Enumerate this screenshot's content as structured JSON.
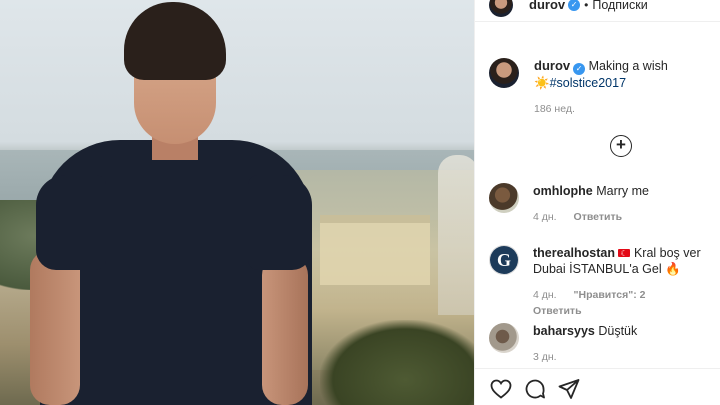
{
  "header": {
    "username": "durov",
    "separator": "•",
    "follow_label": "Подписки"
  },
  "caption": {
    "username": "durov",
    "text": "Making a wish",
    "emoji": "☀️",
    "hashtag": "#solstice2017",
    "time": "186 нед."
  },
  "load_more": "+",
  "comments": [
    {
      "username": "omhlophe",
      "text": "Marry me",
      "time": "4 дн.",
      "reply": "Ответить",
      "likes": ""
    },
    {
      "username": "therealhostan",
      "text_a": "Kral boş ver",
      "text_b": "Dubai İSTANBUL'a Gel",
      "emoji": "🔥",
      "time": "4 дн.",
      "likes": "\"Нравится\": 2",
      "reply": "Ответить"
    },
    {
      "username": "baharsyys",
      "text": "Düştük",
      "time": "3 дн."
    }
  ],
  "icons": {
    "verified": "verified-badge-icon",
    "like": "heart-icon",
    "comment": "comment-icon",
    "share": "share-icon"
  }
}
